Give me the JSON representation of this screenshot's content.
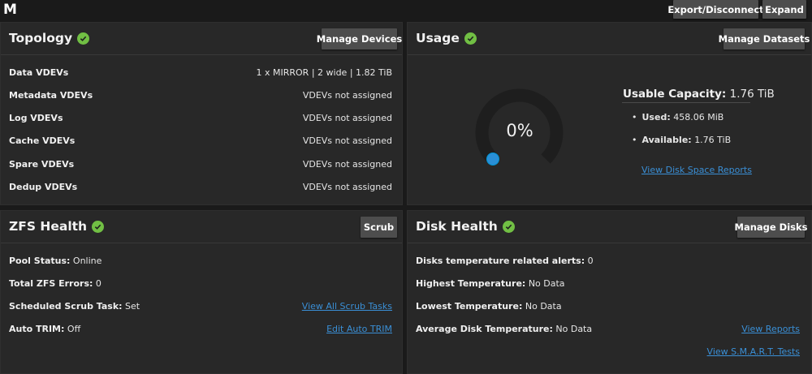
{
  "header": {
    "pool_name": "M",
    "export_label": "Export/Disconnect",
    "expand_label": "Expand"
  },
  "topology": {
    "title": "Topology",
    "button": "Manage Devices",
    "rows": [
      {
        "label": "Data VDEVs",
        "value": "1 x MIRROR | 2 wide | 1.82 TiB"
      },
      {
        "label": "Metadata VDEVs",
        "value": "VDEVs not assigned"
      },
      {
        "label": "Log VDEVs",
        "value": "VDEVs not assigned"
      },
      {
        "label": "Cache VDEVs",
        "value": "VDEVs not assigned"
      },
      {
        "label": "Spare VDEVs",
        "value": "VDEVs not assigned"
      },
      {
        "label": "Dedup VDEVs",
        "value": "VDEVs not assigned"
      }
    ]
  },
  "usage": {
    "title": "Usage",
    "button": "Manage Datasets",
    "percent_text": "0%",
    "used_fraction": 0.0,
    "capacity_label": "Usable Capacity:",
    "capacity_value": "1.76 TiB",
    "used_label": "Used:",
    "used_value": "458.06 MiB",
    "available_label": "Available:",
    "available_value": "1.76 TiB",
    "report_link": "View Disk Space Reports",
    "colors": {
      "gauge_track": "#1e1e1e",
      "gauge_fill": "#0095d5"
    }
  },
  "zfs_health": {
    "title": "ZFS Health",
    "button": "Scrub",
    "pool_status_label": "Pool Status:",
    "pool_status_value": "Online",
    "errors_label": "Total ZFS Errors:",
    "errors_value": "0",
    "scrub_label": "Scheduled Scrub Task:",
    "scrub_value": "Set",
    "scrub_link": "View All Scrub Tasks",
    "trim_label": "Auto TRIM:",
    "trim_value": "Off",
    "trim_link": "Edit Auto TRIM"
  },
  "disk_health": {
    "title": "Disk Health",
    "button": "Manage Disks",
    "alerts_label": "Disks temperature related alerts:",
    "alerts_value": "0",
    "highest_label": "Highest Temperature:",
    "highest_value": "No Data",
    "lowest_label": "Lowest Temperature:",
    "lowest_value": "No Data",
    "average_label": "Average Disk Temperature:",
    "average_value": "No Data",
    "reports_link": "View Reports",
    "smart_link": "View S.M.A.R.T. Tests"
  },
  "colors": {
    "status_ok": "#71bf44",
    "link": "#3a8fd6"
  },
  "icons": {
    "status": "check-circle-icon"
  }
}
